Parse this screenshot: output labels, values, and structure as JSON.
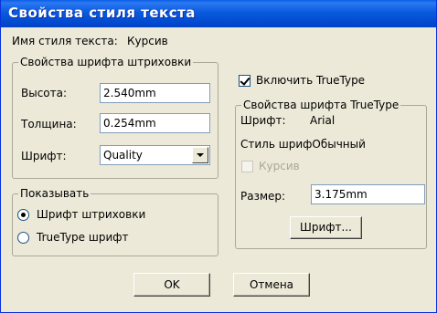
{
  "dialog": {
    "title": "Свойства стиля текста",
    "style_name_label": "Имя стиля текста:",
    "style_name_value": "Курсив"
  },
  "hatch_group": {
    "label": "Свойства шрифта штриховки",
    "height_label": "Высота:",
    "height_value": "2.540mm",
    "thickness_label": "Толщина:",
    "thickness_value": "0.254mm",
    "font_label": "Шрифт:",
    "font_value": "Quality"
  },
  "show_group": {
    "label": "Показывать",
    "options": [
      {
        "label": "Шрифт штриховки",
        "selected": true
      },
      {
        "label": "TrueType шрифт",
        "selected": false
      }
    ]
  },
  "truetype": {
    "enable_label": "Включить TrueType",
    "enabled": true,
    "group_label": "Свойства шрифта TrueType",
    "font_label": "Шрифт:",
    "font_value": "Arial",
    "style_label": "Стиль шрифОбычный",
    "italic_label": "Курсив",
    "italic_checked": false,
    "size_label": "Размер:",
    "size_value": "3.175mm",
    "font_button": "Шрифт..."
  },
  "buttons": {
    "ok": "OK",
    "cancel": "Отмена"
  }
}
